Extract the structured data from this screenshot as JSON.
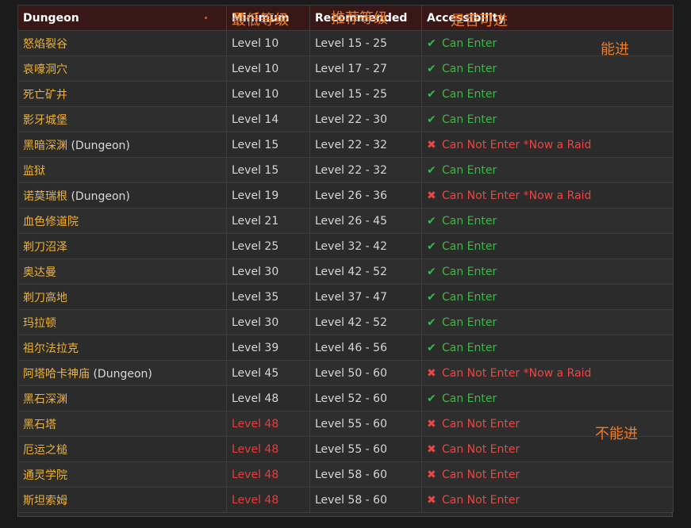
{
  "table": {
    "headers": {
      "dungeon": "Dungeon",
      "min_level": "Minimum",
      "recommended": "Recommended",
      "accessibility": "Accessibility"
    },
    "rows": [
      {
        "name": "怒焰裂谷",
        "suffix": "",
        "min": "Level 10",
        "rec": "Level 15 - 25",
        "access": "Can Enter",
        "ok": true
      },
      {
        "name": "哀嚎洞穴",
        "suffix": "",
        "min": "Level 10",
        "rec": "Level 17 - 27",
        "access": "Can Enter",
        "ok": true
      },
      {
        "name": "死亡矿井",
        "suffix": "",
        "min": "Level 10",
        "rec": "Level 15 - 25",
        "access": "Can Enter",
        "ok": true
      },
      {
        "name": "影牙城堡",
        "suffix": "",
        "min": "Level 14",
        "rec": "Level 22 - 30",
        "access": "Can Enter",
        "ok": true
      },
      {
        "name": "黑暗深渊",
        "suffix": " (Dungeon)",
        "min": "Level 15",
        "rec": "Level 22 - 32",
        "access": "Can Not Enter *Now a Raid",
        "ok": false
      },
      {
        "name": "监狱",
        "suffix": "",
        "min": "Level 15",
        "rec": "Level 22 - 32",
        "access": "Can Enter",
        "ok": true
      },
      {
        "name": "诺莫瑞根",
        "suffix": " (Dungeon)",
        "min": "Level 19",
        "rec": "Level 26 - 36",
        "access": "Can Not Enter *Now a Raid",
        "ok": false
      },
      {
        "name": "血色修道院",
        "suffix": "",
        "min": "Level 21",
        "rec": "Level 26 - 45",
        "access": "Can Enter",
        "ok": true
      },
      {
        "name": "剃刀沼泽",
        "suffix": "",
        "min": "Level 25",
        "rec": "Level 32 - 42",
        "access": "Can Enter",
        "ok": true
      },
      {
        "name": "奥达曼",
        "suffix": "",
        "min": "Level 30",
        "rec": "Level 42 - 52",
        "access": "Can Enter",
        "ok": true
      },
      {
        "name": "剃刀高地",
        "suffix": "",
        "min": "Level 35",
        "rec": "Level 37 - 47",
        "access": "Can Enter",
        "ok": true
      },
      {
        "name": "玛拉顿",
        "suffix": "",
        "min": "Level 30",
        "rec": "Level 42 - 52",
        "access": "Can Enter",
        "ok": true
      },
      {
        "name": "祖尔法拉克",
        "suffix": "",
        "min": "Level 39",
        "rec": "Level 46 - 56",
        "access": "Can Enter",
        "ok": true
      },
      {
        "name": "阿塔哈卡神庙",
        "suffix": " (Dungeon)",
        "min": "Level 45",
        "rec": "Level 50 - 60",
        "access": "Can Not Enter *Now a Raid",
        "ok": false
      },
      {
        "name": "黑石深渊",
        "suffix": "",
        "min": "Level 48",
        "rec": "Level 52 - 60",
        "access": "Can Enter",
        "ok": true
      },
      {
        "name": "黑石塔",
        "suffix": "",
        "min": "Level 48",
        "rec": "Level 55 - 60",
        "access": "Can Not Enter",
        "ok": false,
        "min_restricted": true
      },
      {
        "name": "厄运之槌",
        "suffix": "",
        "min": "Level 48",
        "rec": "Level 55 - 60",
        "access": "Can Not Enter",
        "ok": false,
        "min_restricted": true
      },
      {
        "name": "通灵学院",
        "suffix": "",
        "min": "Level 48",
        "rec": "Level 58 - 60",
        "access": "Can Not Enter",
        "ok": false,
        "min_restricted": true
      },
      {
        "name": "斯坦索姆",
        "suffix": "",
        "min": "Level 48",
        "rec": "Level 58 - 60",
        "access": "Can Not Enter",
        "ok": false,
        "min_restricted": true
      }
    ]
  },
  "annotations": {
    "min_level": "最低等级",
    "recommended": "推荐等级",
    "accessibility": "是否可进",
    "can_enter": "能进",
    "cannot_enter": "不能进"
  },
  "icons": {
    "ok": "check-icon",
    "no": "cross-icon"
  },
  "colors": {
    "header_bg": "#3a1717",
    "dungeon_name": "#f0b232",
    "ok": "#3fb54a",
    "no": "#e94646",
    "annotation": "#f47b22"
  }
}
